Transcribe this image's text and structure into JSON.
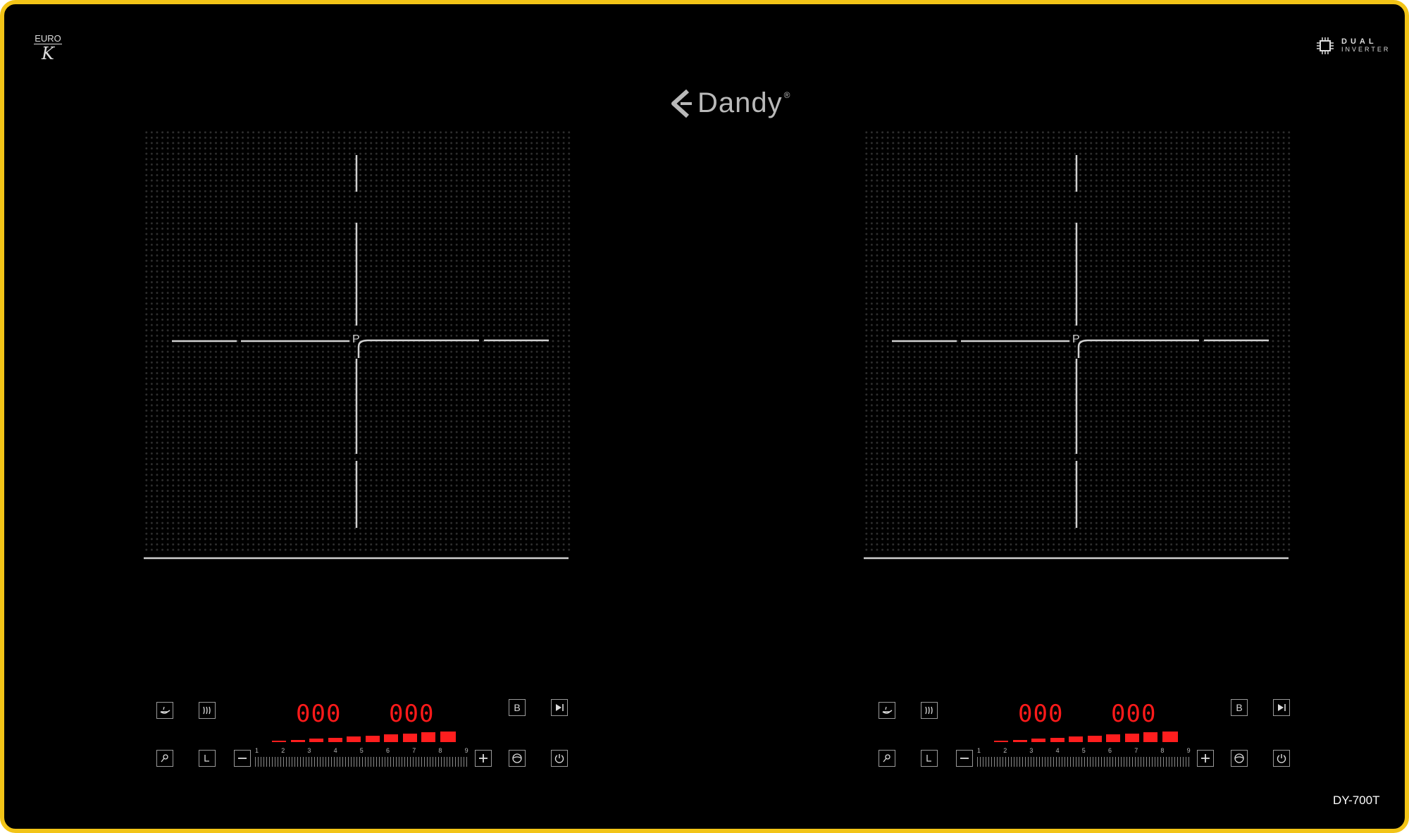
{
  "badges": {
    "euro": "EURO",
    "euro_mark": "K",
    "dual_line1": "DUAL",
    "dual_line2": "INVERTER"
  },
  "brand": {
    "name": "Dandy",
    "reg": "®"
  },
  "model": "DY-700T",
  "zones": [
    {
      "center_label": "P"
    },
    {
      "center_label": "P"
    }
  ],
  "panels": [
    {
      "display_left": "000",
      "display_right": "000",
      "boost_label": "B",
      "scale": [
        "1",
        "2",
        "3",
        "4",
        "5",
        "6",
        "7",
        "8",
        "9"
      ],
      "power_levels_active": 10
    },
    {
      "display_left": "000",
      "display_right": "000",
      "boost_label": "B",
      "scale": [
        "1",
        "2",
        "3",
        "4",
        "5",
        "6",
        "7",
        "8",
        "9"
      ],
      "power_levels_active": 10
    }
  ],
  "icons": [
    "pan-icon",
    "heat-icon",
    "lock-icon",
    "timer-icon",
    "minus-icon",
    "plus-icon",
    "boost-icon",
    "play-pause-icon",
    "wok-icon",
    "power-icon"
  ],
  "colors": {
    "frame": "#f2c417",
    "surface": "#000000",
    "display": "#ff1a1a"
  }
}
